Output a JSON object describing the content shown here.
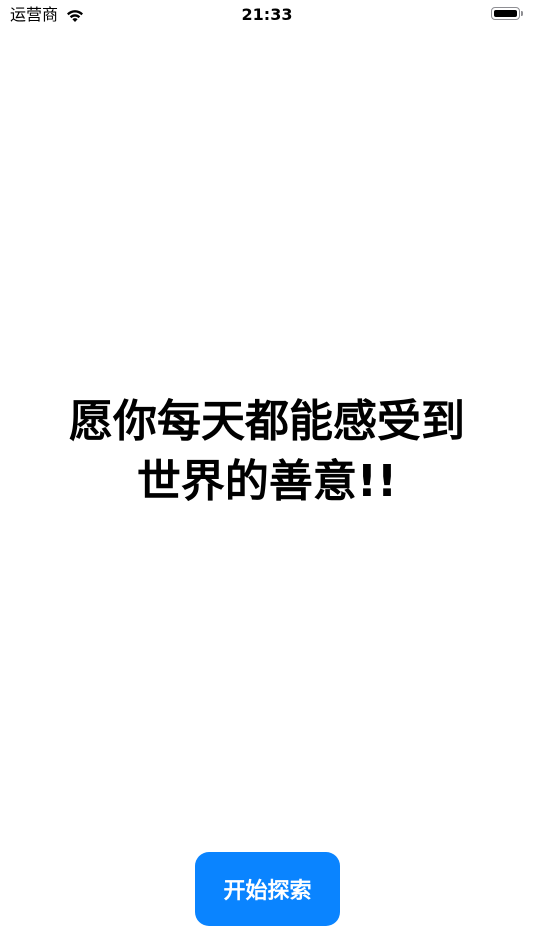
{
  "status_bar": {
    "carrier": "运营商",
    "time": "21:33",
    "wifi_icon": "wifi-icon",
    "battery_icon": "battery-full-icon"
  },
  "main": {
    "message_line1": "愿你每天都能感受到",
    "message_line2": "世界的善意!!"
  },
  "actions": {
    "start_label": "开始探索"
  },
  "colors": {
    "accent": "#0a84ff",
    "text": "#000000",
    "background": "#ffffff"
  }
}
